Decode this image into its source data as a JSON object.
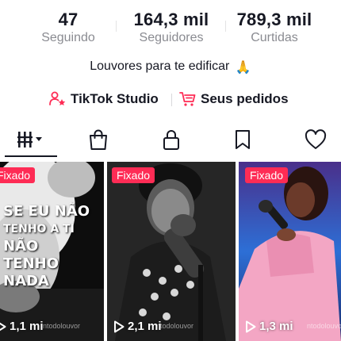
{
  "stats": {
    "following": {
      "value": "47",
      "label": "Seguindo"
    },
    "followers": {
      "value": "164,3 mil",
      "label": "Seguidores"
    },
    "likes": {
      "value": "789,3 mil",
      "label": "Curtidas"
    }
  },
  "bio": {
    "text": "Louvores para te edificar",
    "emoji": "🙏"
  },
  "links": {
    "studio_label": "TikTok Studio",
    "orders_label": "Seus pedidos",
    "accent": "#fe2c55"
  },
  "tabs": [
    {
      "name": "videos",
      "icon": "grid-icon",
      "active": true
    },
    {
      "name": "shop",
      "icon": "shopping-bag-icon"
    },
    {
      "name": "private",
      "icon": "lock-icon"
    },
    {
      "name": "saved",
      "icon": "bookmark-icon"
    },
    {
      "name": "liked",
      "icon": "heart-icon"
    }
  ],
  "videos": [
    {
      "pinned_label": "Fixado",
      "views": "1,1 mi",
      "watermark": "ntodolouvor",
      "overlay_lines": [
        "SE EU NÃO",
        "TENHO A TI",
        "NÃO",
        "TENHO",
        "NADA"
      ]
    },
    {
      "pinned_label": "Fixado",
      "views": "2,1 mi",
      "watermark": "ntodolouvor"
    },
    {
      "pinned_label": "Fixado",
      "views": "1,3 mi",
      "watermark": "ntodolouvor"
    }
  ]
}
